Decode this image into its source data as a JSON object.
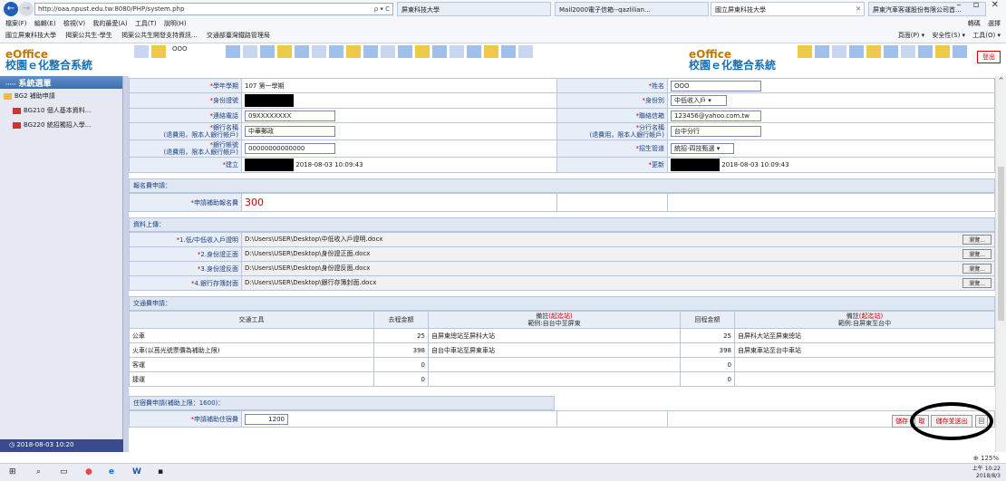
{
  "browser": {
    "url": "http://oaa.npust.edu.tw:8080/PHP/system.php",
    "addr_icons": "ρ ▾ C",
    "tabs": [
      {
        "label": "屏東科技大學"
      },
      {
        "label": "Mail2000電子信箱--qazlilian..."
      },
      {
        "label": "國立屏東科技大學"
      },
      {
        "label": "屏東汽車客運股份有限公司首..."
      }
    ],
    "win_controls": [
      "–",
      "▫",
      "✕"
    ],
    "menu": [
      "檔案(F)",
      "編輯(E)",
      "檢視(V)",
      "我的最愛(A)",
      "工具(T)",
      "說明(H)"
    ],
    "favorites": [
      "國立屏東科技大學",
      "揭案公共生-學生",
      "揭案公共生開發支持資訊...",
      "交通部臺灣鐵路管理局"
    ],
    "right_top": [
      "轉碼",
      "選擇"
    ],
    "right_tools": [
      "頁面(P) ▾",
      "安全性(S) ▾",
      "工具(O) ▾"
    ]
  },
  "header": {
    "logo_line1": "eOffice",
    "logo_line2": "校園ｅ化整合系統",
    "user": "OOO",
    "logout": "登出"
  },
  "sidebar": {
    "title": "系統選單",
    "items": [
      {
        "label": "BG2 補助申請"
      },
      {
        "label": "BG210 個人基本資料..."
      },
      {
        "label": "BG220 統招獨招入學..."
      }
    ],
    "footer": "2018-08-03 10:20"
  },
  "form": {
    "year_label": "學年學期",
    "year_value": "107 第一學期",
    "name_label": "姓名",
    "name_value": "OOO",
    "id_label": "身份證號",
    "identity_label": "身份別",
    "identity_value": "中低收入戶",
    "phone_label": "連絡電話",
    "phone_value": "09XXXXXXXX",
    "email_label": "聯絡信箱",
    "email_value": "123456@yahoo.com.tw",
    "bank_label": "銀行名稱",
    "bank_sub": "(退費用，限本人銀行帳戶)",
    "bank_value": "中華郵政",
    "branch_label": "分行名稱",
    "branch_sub": "(退費用，限本人銀行帳戶)",
    "branch_value": "台中分行",
    "acct_label": "銀行帳號",
    "acct_sub": "(退費用，限本人銀行帳戶)",
    "acct_value": "00000000000000",
    "channel_label": "招生管道",
    "channel_value": "統招-四技甄選",
    "created_label": "建立",
    "created_value": "2018-08-03 10:09:43",
    "updated_label": "更新",
    "updated_value": "2018-08-03 10:09:43"
  },
  "fee": {
    "section": "報名費申請：",
    "label": "申請補助報名費",
    "value": "300"
  },
  "upload": {
    "section": "資料上傳：",
    "browse": "瀏覽...",
    "rows": [
      {
        "label": "1.低/中低收入戶證明",
        "path": "D:\\Users\\USER\\Desktop\\中低收入戶證明.docx"
      },
      {
        "label": "2.身份證正面",
        "path": "D:\\Users\\USER\\Desktop\\身份證正面.docx"
      },
      {
        "label": "3.身份證反面",
        "path": "D:\\Users\\USER\\Desktop\\身份證反面.docx"
      },
      {
        "label": "4.銀行存簿封面",
        "path": "D:\\Users\\USER\\Desktop\\銀行存簿封面.docx"
      }
    ]
  },
  "transport": {
    "section": "交通費申請：",
    "col_tool": "交通工具",
    "col_go": "去程金額",
    "col_note1": "備註",
    "col_note1_red": "(起迄站)",
    "col_note1_ex": "範例:自台中至屏東",
    "col_back": "回程金額",
    "col_note2": "備註",
    "col_note2_red": "(起迄站)",
    "col_note2_ex": "範例:自屏東至台中",
    "rows": [
      {
        "tool": "公車",
        "go": "25",
        "note1": "自屏東總站至屏科大站",
        "back": "25",
        "note2": "自屏科大站至屏東總站"
      },
      {
        "tool": "火車(以莒光號票價為補助上限)",
        "go": "398",
        "note1": "自台中車站至屏東車站",
        "back": "398",
        "note2": "自屏東車站至台中車站"
      },
      {
        "tool": "客運",
        "go": "0",
        "note1": "",
        "back": "0",
        "note2": ""
      },
      {
        "tool": "捷運",
        "go": "0",
        "note1": "",
        "back": "0",
        "note2": ""
      }
    ]
  },
  "lodging": {
    "section": "住宿費申請(補助上限：1600)：",
    "label": "申請補助住宿費",
    "value": "1200"
  },
  "buttons": {
    "save": "儲存",
    "cancel": "取",
    "save_exit": "儲存並送出",
    "back": "回"
  },
  "status": {
    "zoom": "125%",
    "clock_time": "上午 10:22",
    "clock_date": "2018/8/3"
  }
}
